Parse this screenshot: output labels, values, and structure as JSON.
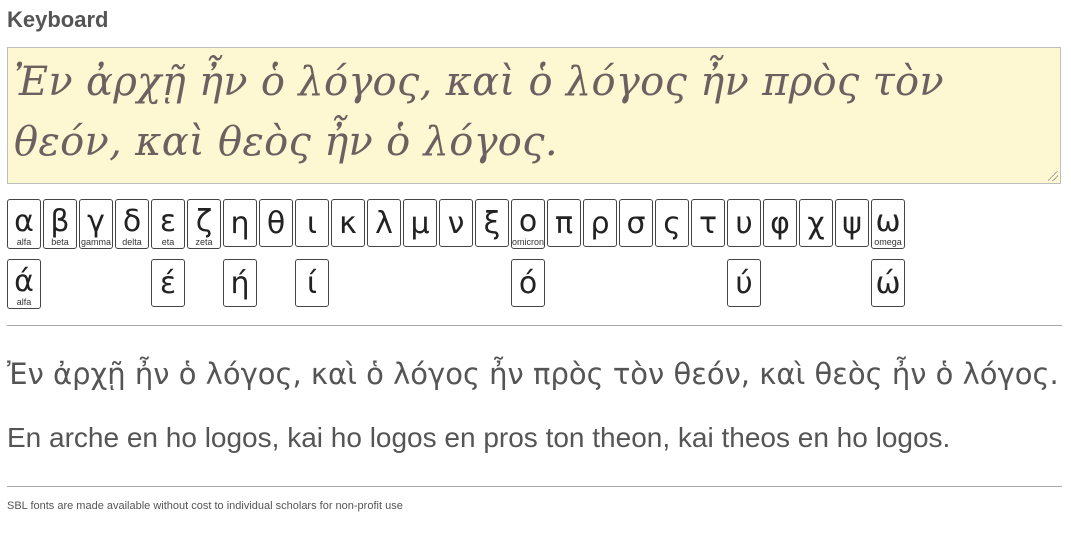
{
  "heading": "Keyboard",
  "editor": {
    "value": "Ἐν ἀρχῇ ἦν ὁ λόγος, καὶ ὁ λόγος ἦν πρὸς τὸν θεόν, καὶ θεὸς ἦν ὁ λόγος."
  },
  "keyboard": {
    "row1": [
      {
        "char": "α",
        "name": "alfa"
      },
      {
        "char": "β",
        "name": "beta"
      },
      {
        "char": "γ",
        "name": "gamma"
      },
      {
        "char": "δ",
        "name": "delta"
      },
      {
        "char": "ε",
        "name": "eta"
      },
      {
        "char": "ζ",
        "name": "zeta"
      },
      {
        "char": "η",
        "name": ""
      },
      {
        "char": "θ",
        "name": ""
      },
      {
        "char": "ι",
        "name": ""
      },
      {
        "char": "κ",
        "name": ""
      },
      {
        "char": "λ",
        "name": ""
      },
      {
        "char": "μ",
        "name": ""
      },
      {
        "char": "ν",
        "name": ""
      },
      {
        "char": "ξ",
        "name": ""
      },
      {
        "char": "ο",
        "name": "omicron"
      },
      {
        "char": "π",
        "name": ""
      },
      {
        "char": "ρ",
        "name": ""
      },
      {
        "char": "σ",
        "name": ""
      },
      {
        "char": "ς",
        "name": ""
      },
      {
        "char": "τ",
        "name": ""
      },
      {
        "char": "υ",
        "name": ""
      },
      {
        "char": "φ",
        "name": ""
      },
      {
        "char": "χ",
        "name": ""
      },
      {
        "char": "ψ",
        "name": ""
      },
      {
        "char": "ω",
        "name": "omega"
      }
    ],
    "row2": [
      {
        "char": "ά",
        "name": "alfa",
        "col": 0
      },
      {
        "char": "έ",
        "name": "",
        "col": 4
      },
      {
        "char": "ή",
        "name": "",
        "col": 6
      },
      {
        "char": "ί",
        "name": "",
        "col": 8
      },
      {
        "char": "ό",
        "name": "",
        "col": 14
      },
      {
        "char": "ύ",
        "name": "",
        "col": 20
      },
      {
        "char": "ώ",
        "name": "",
        "col": 24
      }
    ]
  },
  "output": {
    "greek": "Ἐν ἀρχῇ ἦν ὁ λόγος, καὶ ὁ λόγος ἦν πρὸς τὸν θεόν, καὶ θεὸς ἦν ὁ λόγος.",
    "transliteration": "En arche en ho logos, kai ho logos en pros ton theon, kai theos en ho logos."
  },
  "footnote": "SBL fonts are made available without cost to individual scholars for non-profit use"
}
